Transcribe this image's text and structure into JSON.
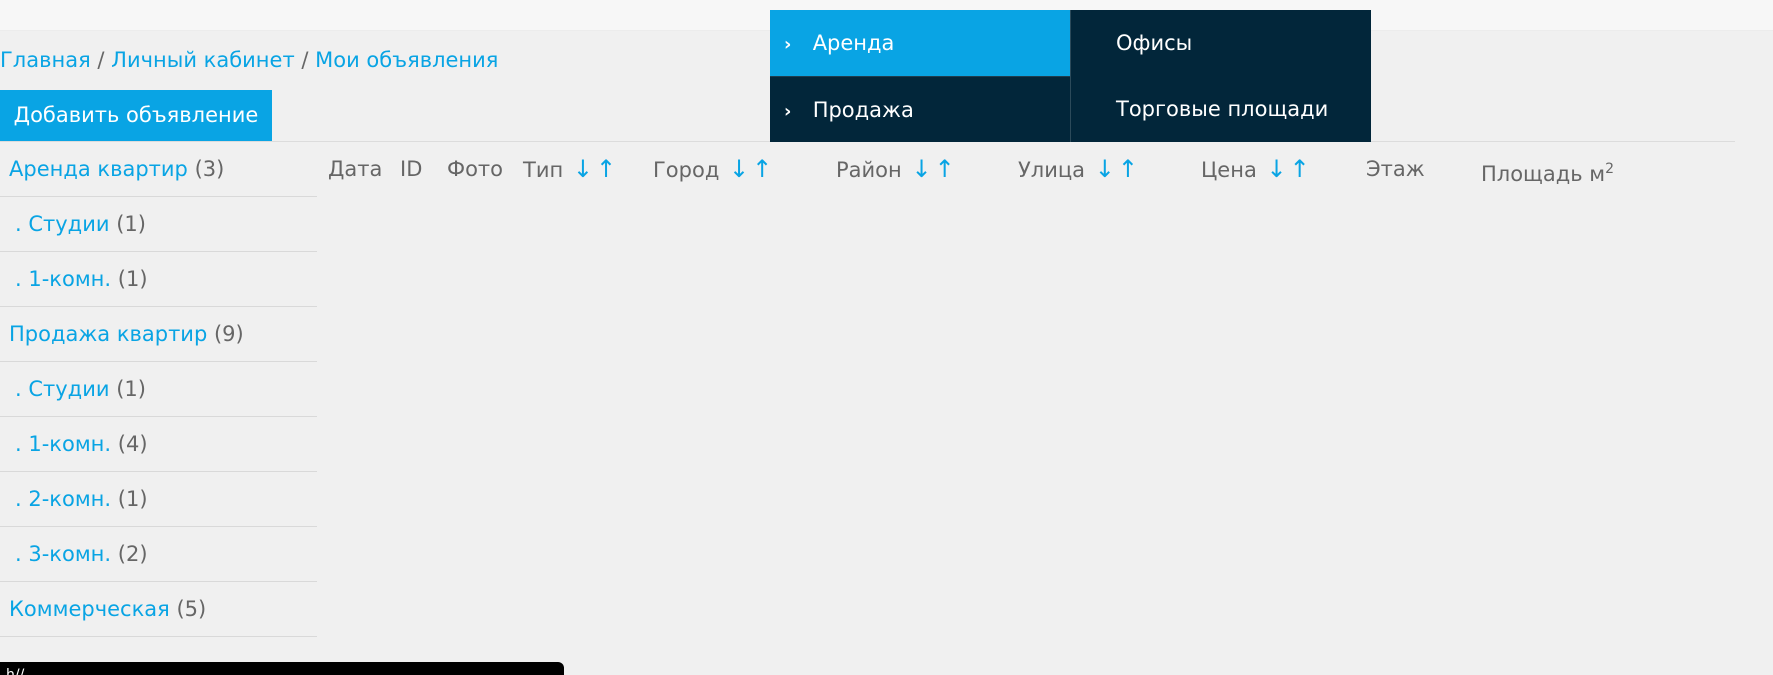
{
  "breadcrumb": {
    "items": [
      "Главная",
      "Личный кабинет",
      "Мои объявления"
    ],
    "separator": "/"
  },
  "actions": {
    "add_listing": "Добавить объявление"
  },
  "sidebar": {
    "items": [
      {
        "label": "Аренда квартир",
        "count": "(3)",
        "level": 1
      },
      {
        "label": ". Студии",
        "count": "(1)",
        "level": 2
      },
      {
        "label": ". 1-комн.",
        "count": "(1)",
        "level": 2
      },
      {
        "label": "Продажа квартир",
        "count": "(9)",
        "level": 1
      },
      {
        "label": ". Студии",
        "count": "(1)",
        "level": 2
      },
      {
        "label": ". 1-комн.",
        "count": "(4)",
        "level": 2
      },
      {
        "label": ". 2-комн.",
        "count": "(1)",
        "level": 2
      },
      {
        "label": ". 3-комн.",
        "count": "(2)",
        "level": 2
      },
      {
        "label": "Коммерческая",
        "count": "(5)",
        "level": 1
      }
    ]
  },
  "table": {
    "columns": [
      {
        "label": "Дата",
        "sortable": false
      },
      {
        "label": "ID",
        "sortable": false
      },
      {
        "label": "Фото",
        "sortable": false
      },
      {
        "label": "Тип",
        "sortable": true
      },
      {
        "label": "Город",
        "sortable": true
      },
      {
        "label": "Район",
        "sortable": true
      },
      {
        "label": "Улица",
        "sortable": true
      },
      {
        "label": "Цена",
        "sortable": true
      },
      {
        "label": "Этаж",
        "sortable": false
      },
      {
        "label": "Площадь м",
        "sup": "2",
        "sortable": false
      }
    ],
    "sort_down": "↓",
    "sort_up": "↑"
  },
  "dropdown_menu": {
    "items": [
      {
        "label": "Аренда",
        "active": true
      },
      {
        "label": "Продажа",
        "active": false
      }
    ],
    "submenu": [
      "Офисы",
      "Торговые площади"
    ]
  },
  "status_bar": {
    "url": "h//"
  },
  "colors": {
    "accent": "#09a4e4",
    "menu_bg": "#02263a",
    "text": "#666666",
    "page_bg": "#f0f0f0"
  }
}
